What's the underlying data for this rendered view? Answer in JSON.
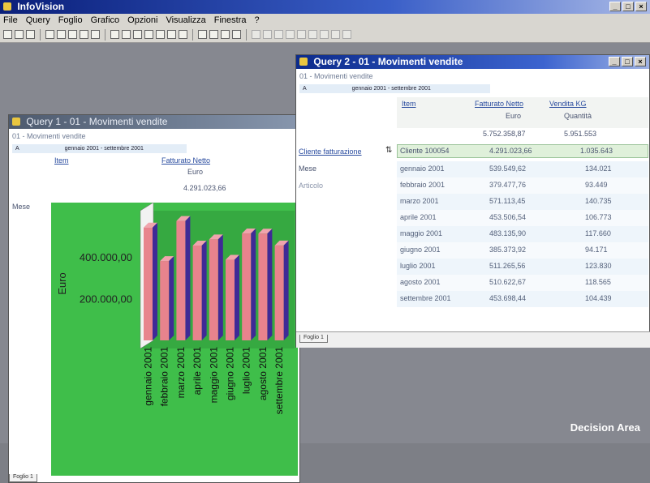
{
  "app": {
    "title": "InfoVision"
  },
  "menu": [
    "File",
    "Query",
    "Foglio",
    "Grafico",
    "Opzioni",
    "Visualizza",
    "Finestra",
    "?"
  ],
  "query1": {
    "title": "Query 1 - 01 - Movimenti vendite",
    "subtitle": "01 - Movimenti vendite",
    "filter_label": "A",
    "filter_value": "gennaio 2001 - settembre 2001",
    "col_item": "Item",
    "col_measure": "Fatturato Netto",
    "col_unit": "Euro",
    "total": "4.291.023,66",
    "row_dim": "Mese",
    "sheet_tab": "Foglio 1"
  },
  "query2": {
    "title": "Query 2 - 01 - Movimenti vendite",
    "subtitle": "01 - Movimenti vendite",
    "filter_label": "A",
    "filter_value": "gennaio 2001 - settembre 2001",
    "col_item": "Item",
    "col_measure1": "Fatturato Netto",
    "col_measure2": "Vendita KG",
    "unit1": "Euro",
    "unit2": "Quantità",
    "grand_total1": "5.752.358,87",
    "grand_total2": "5.951.553",
    "dims": [
      "Cliente fatturazione",
      "Mese",
      "Articolo"
    ],
    "client_label": "Cliente 100054",
    "client_total1": "4.291.023,66",
    "client_total2": "1.035.643",
    "rows": [
      {
        "month": "gennaio 2001",
        "v1": "539.549,62",
        "v2": "134.021"
      },
      {
        "month": "febbraio 2001",
        "v1": "379.477,76",
        "v2": "93.449"
      },
      {
        "month": "marzo 2001",
        "v1": "571.113,45",
        "v2": "140.735"
      },
      {
        "month": "aprile 2001",
        "v1": "453.506,54",
        "v2": "106.773"
      },
      {
        "month": "maggio 2001",
        "v1": "483.135,90",
        "v2": "117.660"
      },
      {
        "month": "giugno 2001",
        "v1": "385.373,92",
        "v2": "94.171"
      },
      {
        "month": "luglio 2001",
        "v1": "511.265,56",
        "v2": "123.830"
      },
      {
        "month": "agosto 2001",
        "v1": "510.622,67",
        "v2": "118.565"
      },
      {
        "month": "settembre 2001",
        "v1": "453.698,44",
        "v2": "104.439"
      }
    ],
    "sheet_tab": "Foglio 1"
  },
  "chart_data": {
    "type": "bar",
    "categories": [
      "gennaio 2001",
      "febbraio 2001",
      "marzo 2001",
      "aprile 2001",
      "maggio 2001",
      "giugno 2001",
      "luglio 2001",
      "agosto 2001",
      "settembre 2001"
    ],
    "values": [
      539549.62,
      379477.76,
      571113.45,
      453506.54,
      483135.9,
      385373.92,
      511265.56,
      510622.67,
      453698.44
    ],
    "title": "",
    "xlabel": "",
    "ylabel": "Euro",
    "tick_labels": [
      "200.000,00",
      "400.000,00"
    ],
    "ylim": [
      0,
      620000
    ],
    "background": "#3fbe4a",
    "bar_color": "#e8838d",
    "bar_side_color": "#3f2a96"
  },
  "branding": {
    "text": "Decision Area"
  }
}
